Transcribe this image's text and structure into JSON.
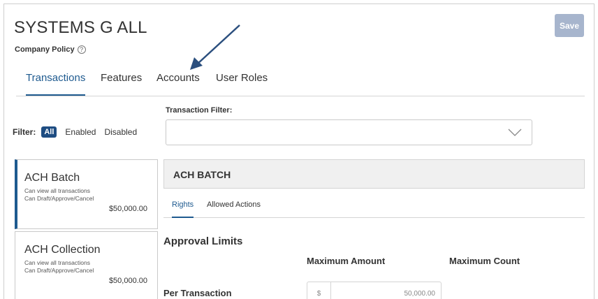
{
  "header": {
    "title": "SYSTEMS G ALL",
    "subtitle": "Company Policy",
    "help_icon": "?",
    "save_label": "Save"
  },
  "tabs": [
    {
      "label": "Transactions",
      "active": true
    },
    {
      "label": "Features",
      "active": false
    },
    {
      "label": "Accounts",
      "active": false
    },
    {
      "label": "User Roles",
      "active": false
    }
  ],
  "filter": {
    "label": "Filter:",
    "options": [
      "All",
      "Enabled",
      "Disabled"
    ],
    "selected": "All"
  },
  "transaction_filter": {
    "label": "Transaction Filter:",
    "value": ""
  },
  "cards": [
    {
      "title": "ACH Batch",
      "line1": "Can view all transactions",
      "line2": "Can Draft/Approve/Cancel",
      "amount": "$50,000.00",
      "selected": true
    },
    {
      "title": "ACH Collection",
      "line1": "Can view all transactions",
      "line2": "Can Draft/Approve/Cancel",
      "amount": "$50,000.00",
      "selected": false
    }
  ],
  "detail": {
    "header": "ACH BATCH",
    "subtabs": [
      "Rights",
      "Allowed Actions"
    ],
    "approval_title": "Approval Limits",
    "col_max_amount": "Maximum Amount",
    "col_max_count": "Maximum Count",
    "row_label": "Per Transaction",
    "amount_prefix": "$",
    "amount_value": "50,000.00"
  },
  "colors": {
    "accent": "#1e5a8f",
    "save_button": "#a7b5cd",
    "arrow": "#2b4f7e"
  }
}
